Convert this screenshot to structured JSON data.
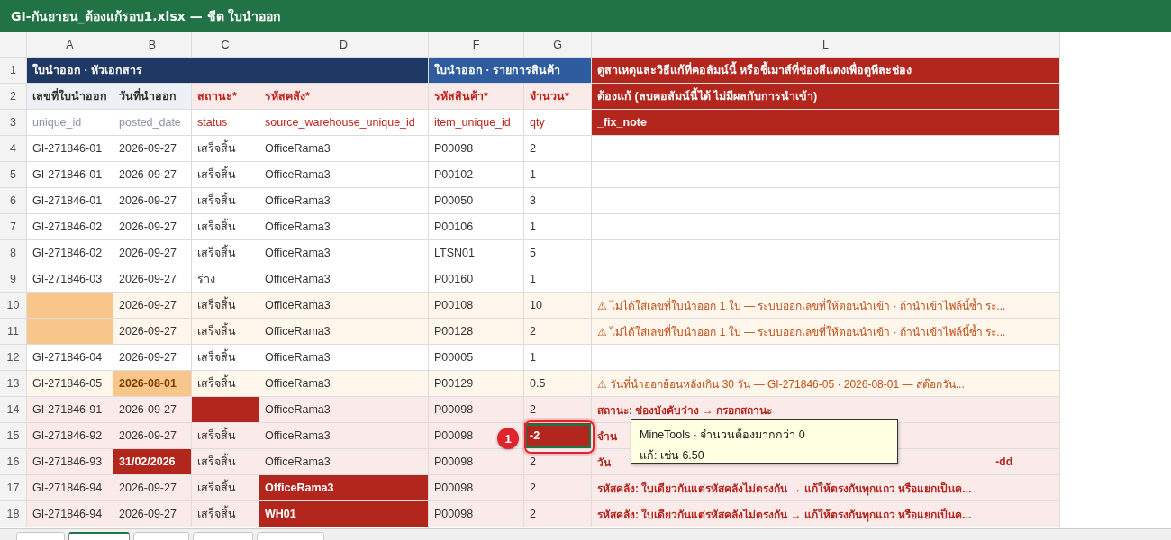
{
  "window": {
    "title": "GI-กันยายน_ต้องแก้รอบ1.xlsx — ชีต ใบนำออก"
  },
  "columns": [
    "A",
    "B",
    "C",
    "D",
    "F",
    "G",
    "L"
  ],
  "header_rows": [
    {
      "num": "1",
      "groups": [
        {
          "text": "ใบนำออก · หัวเอกสาร",
          "kind": "doc"
        },
        {
          "text": "ใบนำออก · รายการสินค้า",
          "kind": "item"
        },
        {
          "text": "ดูสาเหตุและวิธีแก้ที่คอลัมน์นี้ หรือชี้เมาส์ที่ช่องสีแดงเพื่อดูทีละช่อง",
          "kind": "fix"
        }
      ]
    },
    {
      "num": "2",
      "cells": [
        {
          "text": "เลขที่ใบนำออก",
          "kind": "optional"
        },
        {
          "text": "วันที่นำออก",
          "kind": "optional"
        },
        {
          "text": "สถานะ*",
          "kind": "required"
        },
        {
          "text": "รหัสคลัง*",
          "kind": "required"
        },
        {
          "text": "รหัสสินค้า*",
          "kind": "required"
        },
        {
          "text": "จำนวน*",
          "kind": "required"
        },
        {
          "text": "ต้องแก้ (ลบคอลัมน์นี้ได้ ไม่มีผลกับการนำเข้า)",
          "kind": "fix"
        }
      ]
    },
    {
      "num": "3",
      "cells": [
        {
          "text": "unique_id",
          "kind": "optional"
        },
        {
          "text": "posted_date",
          "kind": "optional"
        },
        {
          "text": "status",
          "kind": "required"
        },
        {
          "text": "source_warehouse_unique_id",
          "kind": "required"
        },
        {
          "text": "item_unique_id",
          "kind": "required"
        },
        {
          "text": "qty",
          "kind": "required"
        },
        {
          "text": "_fix_note",
          "kind": "fix"
        }
      ]
    }
  ],
  "rows": [
    {
      "num": "4",
      "warning": false,
      "error": false,
      "cells": [
        "GI-271846-01",
        "2026-09-27",
        "เสร็จสิ้น",
        "OfficeRama3",
        "P00098",
        "2"
      ]
    },
    {
      "num": "5",
      "warning": false,
      "error": false,
      "cells": [
        "GI-271846-01",
        "2026-09-27",
        "เสร็จสิ้น",
        "OfficeRama3",
        "P00102",
        "1"
      ]
    },
    {
      "num": "6",
      "warning": false,
      "error": false,
      "cells": [
        "GI-271846-01",
        "2026-09-27",
        "เสร็จสิ้น",
        "OfficeRama3",
        "P00050",
        "3"
      ]
    },
    {
      "num": "7",
      "warning": false,
      "error": false,
      "cells": [
        "GI-271846-02",
        "2026-09-27",
        "เสร็จสิ้น",
        "OfficeRama3",
        "P00106",
        "1"
      ]
    },
    {
      "num": "8",
      "warning": false,
      "error": false,
      "cells": [
        "GI-271846-02",
        "2026-09-27",
        "เสร็จสิ้น",
        "OfficeRama3",
        "LTSN01",
        "5"
      ]
    },
    {
      "num": "9",
      "warning": false,
      "error": false,
      "cells": [
        "GI-271846-03",
        "2026-09-27",
        "ร่าง",
        "OfficeRama3",
        "P00160",
        "1"
      ]
    },
    {
      "num": "10",
      "warning": true,
      "error": false,
      "cells": [
        {
          "warning": true,
          "error": false
        },
        "2026-09-27",
        "เสร็จสิ้น",
        "OfficeRama3",
        "P00108",
        "10"
      ],
      "note": {
        "error": false,
        "text": "⚠ ไม่ได้ใส่เลขที่ใบนำออก 1 ใบ — ระบบออกเลขที่ให้ตอนนำเข้า · ถ้านำเข้าไฟล์นี้ซ้ำ ระ..."
      }
    },
    {
      "num": "11",
      "warning": true,
      "error": false,
      "cells": [
        {
          "warning": true,
          "error": false
        },
        "2026-09-27",
        "เสร็จสิ้น",
        "OfficeRama3",
        "P00128",
        "2"
      ],
      "note": {
        "error": false,
        "text": "⚠ ไม่ได้ใส่เลขที่ใบนำออก 1 ใบ — ระบบออกเลขที่ให้ตอนนำเข้า · ถ้านำเข้าไฟล์นี้ซ้ำ ระ..."
      }
    },
    {
      "num": "12",
      "warning": false,
      "error": false,
      "cells": [
        "GI-271846-04",
        "2026-09-27",
        "เสร็จสิ้น",
        "OfficeRama3",
        "P00005",
        "1"
      ]
    },
    {
      "num": "13",
      "warning": true,
      "error": false,
      "cells": [
        "GI-271846-05",
        {
          "text": "2026-08-01",
          "warning": true,
          "error": false
        },
        "เสร็จสิ้น",
        "OfficeRama3",
        "P00129",
        "0.5"
      ],
      "note": {
        "error": false,
        "text": "⚠ วันที่นำออกย้อนหลังเกิน 30 วัน — GI-271846-05 · 2026-08-01 — สต๊อกวัน..."
      }
    },
    {
      "num": "14",
      "error": true,
      "cells": [
        "GI-271846-91",
        "2026-09-27",
        {
          "error": true
        },
        "OfficeRama3",
        "P00098",
        "2"
      ],
      "note": {
        "error": true,
        "text": "สถานะ: ช่องบังคับว่าง → กรอกสถานะ"
      }
    },
    {
      "num": "15",
      "error": true,
      "cells": [
        "GI-271846-92",
        "2026-09-27",
        "เสร็จสิ้น",
        "OfficeRama3",
        "P00098",
        {
          "text": "-2",
          "error": true,
          "selected": true
        }
      ],
      "note": {
        "error": true,
        "text": "จำน"
      }
    },
    {
      "num": "16",
      "error": true,
      "cells": [
        "GI-271846-93",
        {
          "text": "31/02/2026",
          "error": true
        },
        "เสร็จสิ้น",
        "OfficeRama3",
        "P00098",
        "2"
      ],
      "note": {
        "error": true,
        "text": "วัน",
        "tail": "-dd"
      }
    },
    {
      "num": "17",
      "error": true,
      "cells": [
        "GI-271846-94",
        "2026-09-27",
        "เสร็จสิ้น",
        {
          "text": "OfficeRama3",
          "error": true
        },
        "P00098",
        "2"
      ],
      "note": {
        "error": true,
        "text": "รหัสคลัง: ใบเดียวกันแต่รหัสคลังไม่ตรงกัน → แก้ให้ตรงกันทุกแถว หรือแยกเป็นค..."
      }
    },
    {
      "num": "18",
      "error": true,
      "cells": [
        "GI-271846-94",
        "2026-09-27",
        "เสร็จสิ้น",
        {
          "text": "WH01",
          "error": true
        },
        "P00098",
        "2"
      ],
      "note": {
        "error": true,
        "text": "รหัสคลัง: ใบเดียวกันแต่รหัสคลังไม่ตรงกัน → แก้ให้ตรงกันทุกแถว หรือแยกเป็นค..."
      }
    }
  ],
  "callout": {
    "label": "1",
    "tooltip": [
      "MineTools · จำนวนต้องมากกว่า 0",
      "แก้: เช่น 6.50"
    ]
  },
  "sheet_tabs": [
    {
      "selected": false
    },
    {
      "selected": true
    },
    {
      "selected": false
    },
    {
      "selected": false
    },
    {
      "selected": false
    }
  ]
}
